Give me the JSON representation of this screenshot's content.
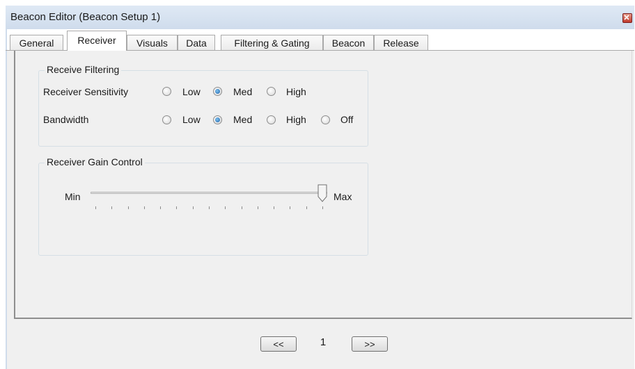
{
  "window": {
    "title": "Beacon Editor (Beacon Setup 1)"
  },
  "tabs": [
    {
      "label": "General"
    },
    {
      "label": "Receiver",
      "active": true
    },
    {
      "label": "Visuals"
    },
    {
      "label": "Data"
    },
    {
      "label": "Filtering & Gating"
    },
    {
      "label": "Beacon"
    },
    {
      "label": "Release"
    }
  ],
  "receive_filtering": {
    "title": "Receive Filtering",
    "sensitivity": {
      "label": "Receiver Sensitivity",
      "options": [
        "Low",
        "Med",
        "High"
      ],
      "selected": "Med"
    },
    "bandwidth": {
      "label": "Bandwidth",
      "options": [
        "Low",
        "Med",
        "High",
        "Off"
      ],
      "selected": "Med"
    }
  },
  "gain_control": {
    "title": "Receiver Gain Control",
    "min_label": "Min",
    "max_label": "Max",
    "tick_count": 15,
    "value_fraction": 1.0
  },
  "footer": {
    "prev_label": "<<",
    "page": "1",
    "next_label": ">>"
  },
  "colors": {
    "titlebar": "#cfdcec",
    "panel": "#f0f0f0",
    "radio_selected": "#1b5fa8",
    "close_button": "#c0392b"
  }
}
